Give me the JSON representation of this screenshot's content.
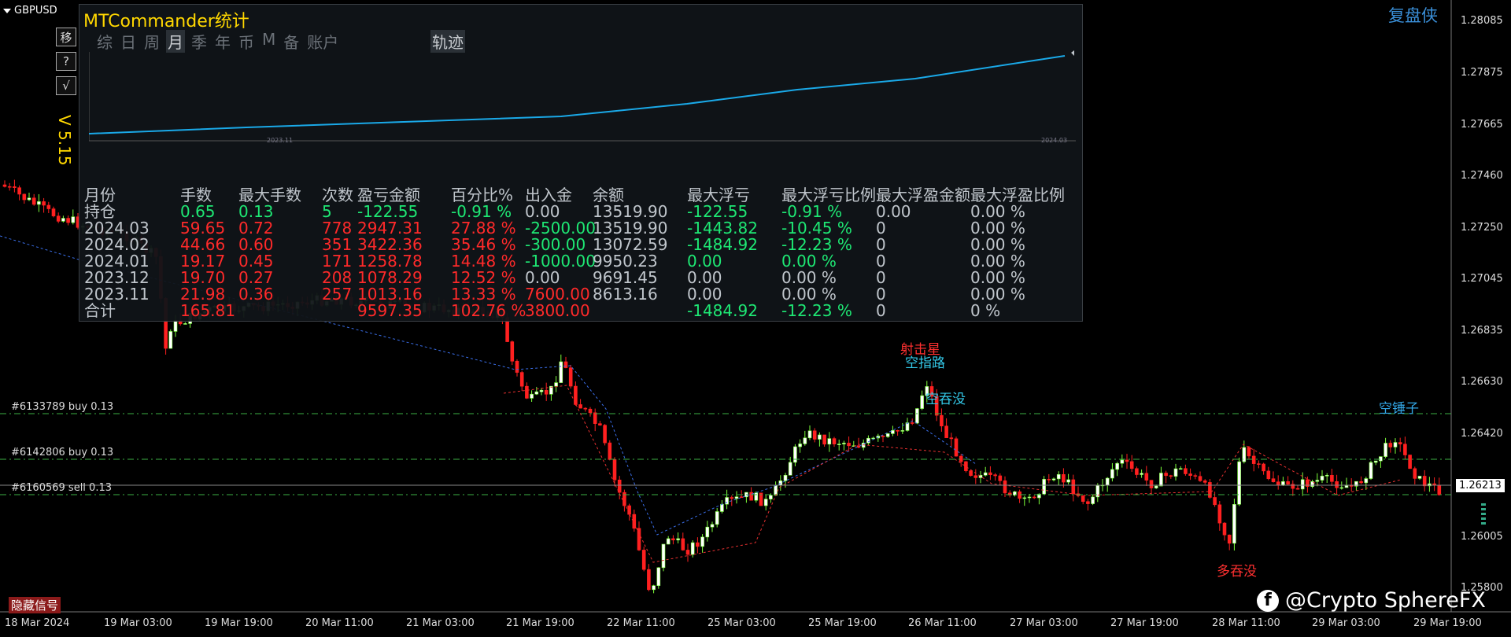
{
  "symbol": "GBPUSD",
  "side_buttons": [
    "移",
    "?",
    "√"
  ],
  "version": "V 5.15",
  "panel": {
    "title": "MTCommander统计",
    "tabs": [
      "综",
      "日",
      "周",
      "月",
      "季",
      "年",
      "币",
      "M",
      "备",
      "账户"
    ],
    "selected_tab": "月",
    "track_tab": "轨迹",
    "mini_chart_labels": [
      "2023.11",
      "2024.03"
    ]
  },
  "stats": {
    "headers": [
      "月份",
      "手数",
      "最大手数",
      "次数",
      "盈亏金额",
      "百分比%",
      "出入金",
      "余额",
      "最大浮亏",
      "最大浮亏比例",
      "最大浮盈金额",
      "最大浮盈比例"
    ],
    "rows": [
      [
        "持仓",
        "0.65",
        "0.13",
        "5",
        "-122.55",
        "-0.91 %",
        "0.00",
        "13519.90",
        "-122.55",
        "-0.91 %",
        "0.00",
        "0.00 %"
      ],
      [
        "2024.03",
        "59.65",
        "0.72",
        "778",
        "2947.31",
        "27.88 %",
        "-2500.00",
        "13519.90",
        "-1443.82",
        "-10.45 %",
        "0",
        "0.00 %"
      ],
      [
        "2024.02",
        "44.66",
        "0.60",
        "351",
        "3422.36",
        "35.46 %",
        "-300.00",
        "13072.59",
        "-1484.92",
        "-12.23 %",
        "0",
        "0.00 %"
      ],
      [
        "2024.01",
        "19.17",
        "0.45",
        "171",
        "1258.78",
        "14.48 %",
        "-1000.00",
        "9950.23",
        "0.00",
        "0.00 %",
        "0",
        "0.00 %"
      ],
      [
        "2023.12",
        "19.70",
        "0.27",
        "208",
        "1078.29",
        "12.52 %",
        "0.00",
        "9691.45",
        "0.00",
        "0.00 %",
        "0",
        "0.00 %"
      ],
      [
        "2023.11",
        "21.98",
        "0.36",
        "257",
        "1013.16",
        "13.33 %",
        "7600.00",
        "8613.16",
        "0.00",
        "0.00 %",
        "0",
        "0.00 %"
      ]
    ],
    "total": [
      "合计",
      "165.81",
      "",
      "",
      "9597.35",
      "102.76 %",
      "3800.00",
      "",
      "-1484.92",
      "-12.23 %",
      "0",
      "0 %"
    ]
  },
  "price_axis": [
    "1.28085",
    "1.27875",
    "1.27665",
    "1.27460",
    "1.27250",
    "1.27045",
    "1.26835",
    "1.26630",
    "1.26420",
    "1.26213",
    "1.26005",
    "1.25800"
  ],
  "current_price": "1.26213",
  "time_axis": [
    "18 Mar 2024",
    "19 Mar 03:00",
    "19 Mar 19:00",
    "20 Mar 11:00",
    "21 Mar 03:00",
    "21 Mar 19:00",
    "22 Mar 11:00",
    "25 Mar 03:00",
    "25 Mar 19:00",
    "26 Mar 11:00",
    "27 Mar 03:00",
    "27 Mar 19:00",
    "28 Mar 11:00",
    "29 Mar 03:00",
    "29 Mar 19:00"
  ],
  "orders": [
    "#6133789 buy 0.13",
    "#6142806 buy 0.13",
    "#6160569 sell 0.13"
  ],
  "annotations": {
    "a1": "射击星",
    "a2": "空指路",
    "a3": "空吞没",
    "a4": "空锤子",
    "a5": "多吞没"
  },
  "hide_signals_label": "隐藏信号",
  "replay_label": "复盘侠",
  "brand": "@Crypto SphereFX",
  "colors": {
    "bull": "#7cff3a",
    "bear": "#ff2020",
    "accent": "#ffd700",
    "curve": "#1aa9e8",
    "green_text": "#1ee874",
    "red_text": "#ff2a2a"
  }
}
